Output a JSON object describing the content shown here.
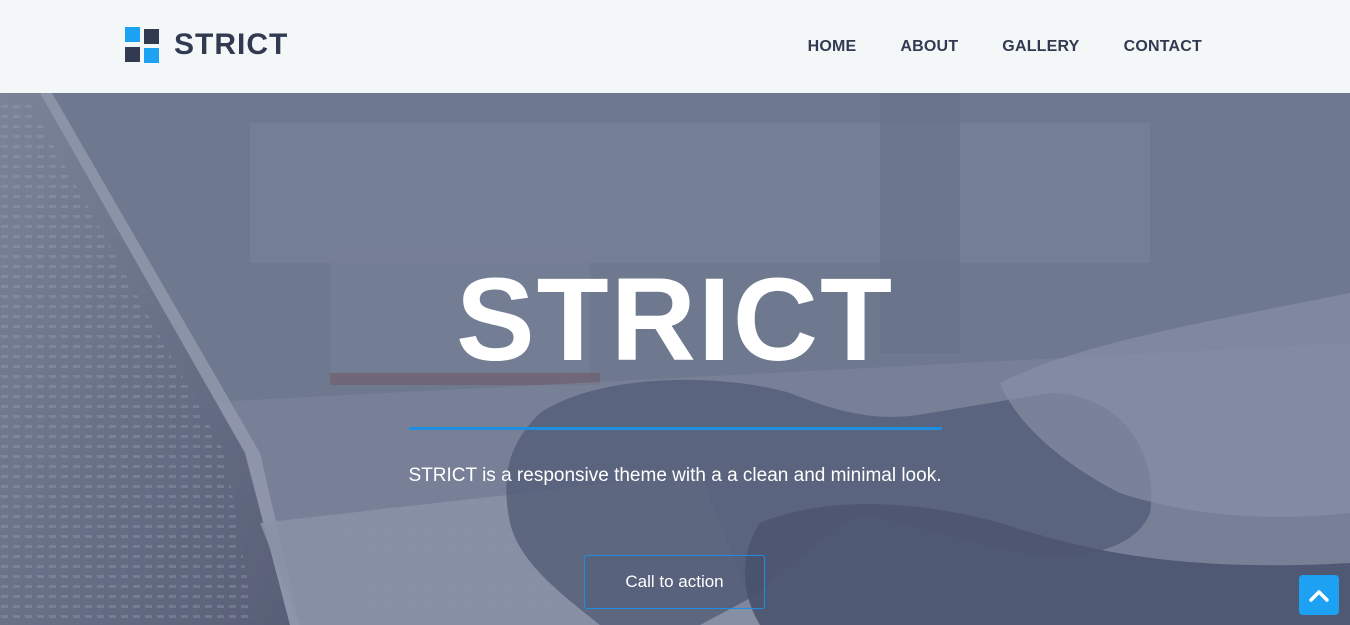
{
  "brand": {
    "name": "STRICT",
    "accent_color": "#1da1f2",
    "dark_color": "#323a52"
  },
  "nav": {
    "items": [
      {
        "label": "HOME"
      },
      {
        "label": "ABOUT"
      },
      {
        "label": "GALLERY"
      },
      {
        "label": "CONTACT"
      }
    ]
  },
  "hero": {
    "title": "STRICT",
    "subtitle": "STRICT is a responsive theme with a a clean and minimal look.",
    "cta_label": "Call to action"
  },
  "scroll_top": {
    "icon": "chevron-up-icon"
  }
}
